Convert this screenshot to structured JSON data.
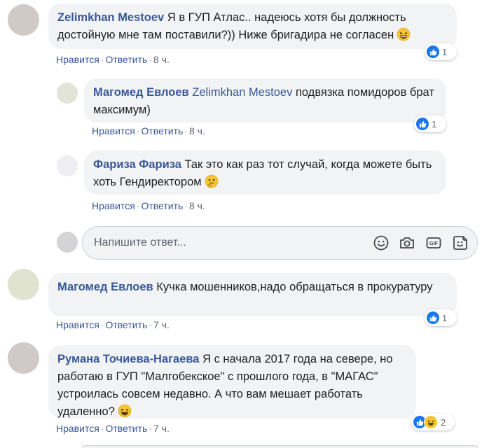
{
  "comments": [
    {
      "author": "Zelimkhan Mestoev",
      "text": "Я в ГУП Атлас.. надеюсь хотя бы должность достойную мне там поставили?)) Ниже бригадира не согласен",
      "like_label": "Нравится",
      "reply_label": "Ответить",
      "time": "8 ч.",
      "reactions": {
        "count": "1"
      },
      "replies": [
        {
          "author": "Магомед Евлоев",
          "mention": "Zelimkhan Mestoev",
          "text": "подвязка помидоров брат максимум)",
          "like_label": "Нравится",
          "reply_label": "Ответить",
          "time": "8 ч.",
          "reactions": {
            "count": "1"
          }
        },
        {
          "author": "Фариза Фариза",
          "text": "Так это как раз тот случай, когда можете быть хоть Гендиректором",
          "like_label": "Нравится",
          "reply_label": "Ответить",
          "time": "8 ч."
        }
      ]
    },
    {
      "author": "Магомед Евлоев",
      "text": "Кучка мошенников,надо обращаться в прокуратуру",
      "like_label": "Нравится",
      "reply_label": "Ответить",
      "time": "7 ч.",
      "reactions": {
        "count": "1"
      }
    },
    {
      "author": "Румана Точиева-Нагаева",
      "text": "Я с начала 2017 года на севере, но работаю в ГУП \"Малгобекское\" с прошлого года, в \"МАГАС\" устроилась совсем недавно. А что вам мешает работать удаленно?",
      "like_label": "Нравится",
      "reply_label": "Ответить",
      "time": "7 ч.",
      "reactions": {
        "count": "2"
      }
    }
  ],
  "reply_box": {
    "placeholder": "Напишите ответ..."
  },
  "icons": {
    "emoji_picker": "smiley-icon",
    "camera": "camera-icon",
    "gif": "gif-icon",
    "sticker": "sticker-icon",
    "gif_label": "GIF"
  },
  "colors": {
    "link": "#385898",
    "bubble": "#f2f3f5",
    "like": "#1877f2"
  }
}
